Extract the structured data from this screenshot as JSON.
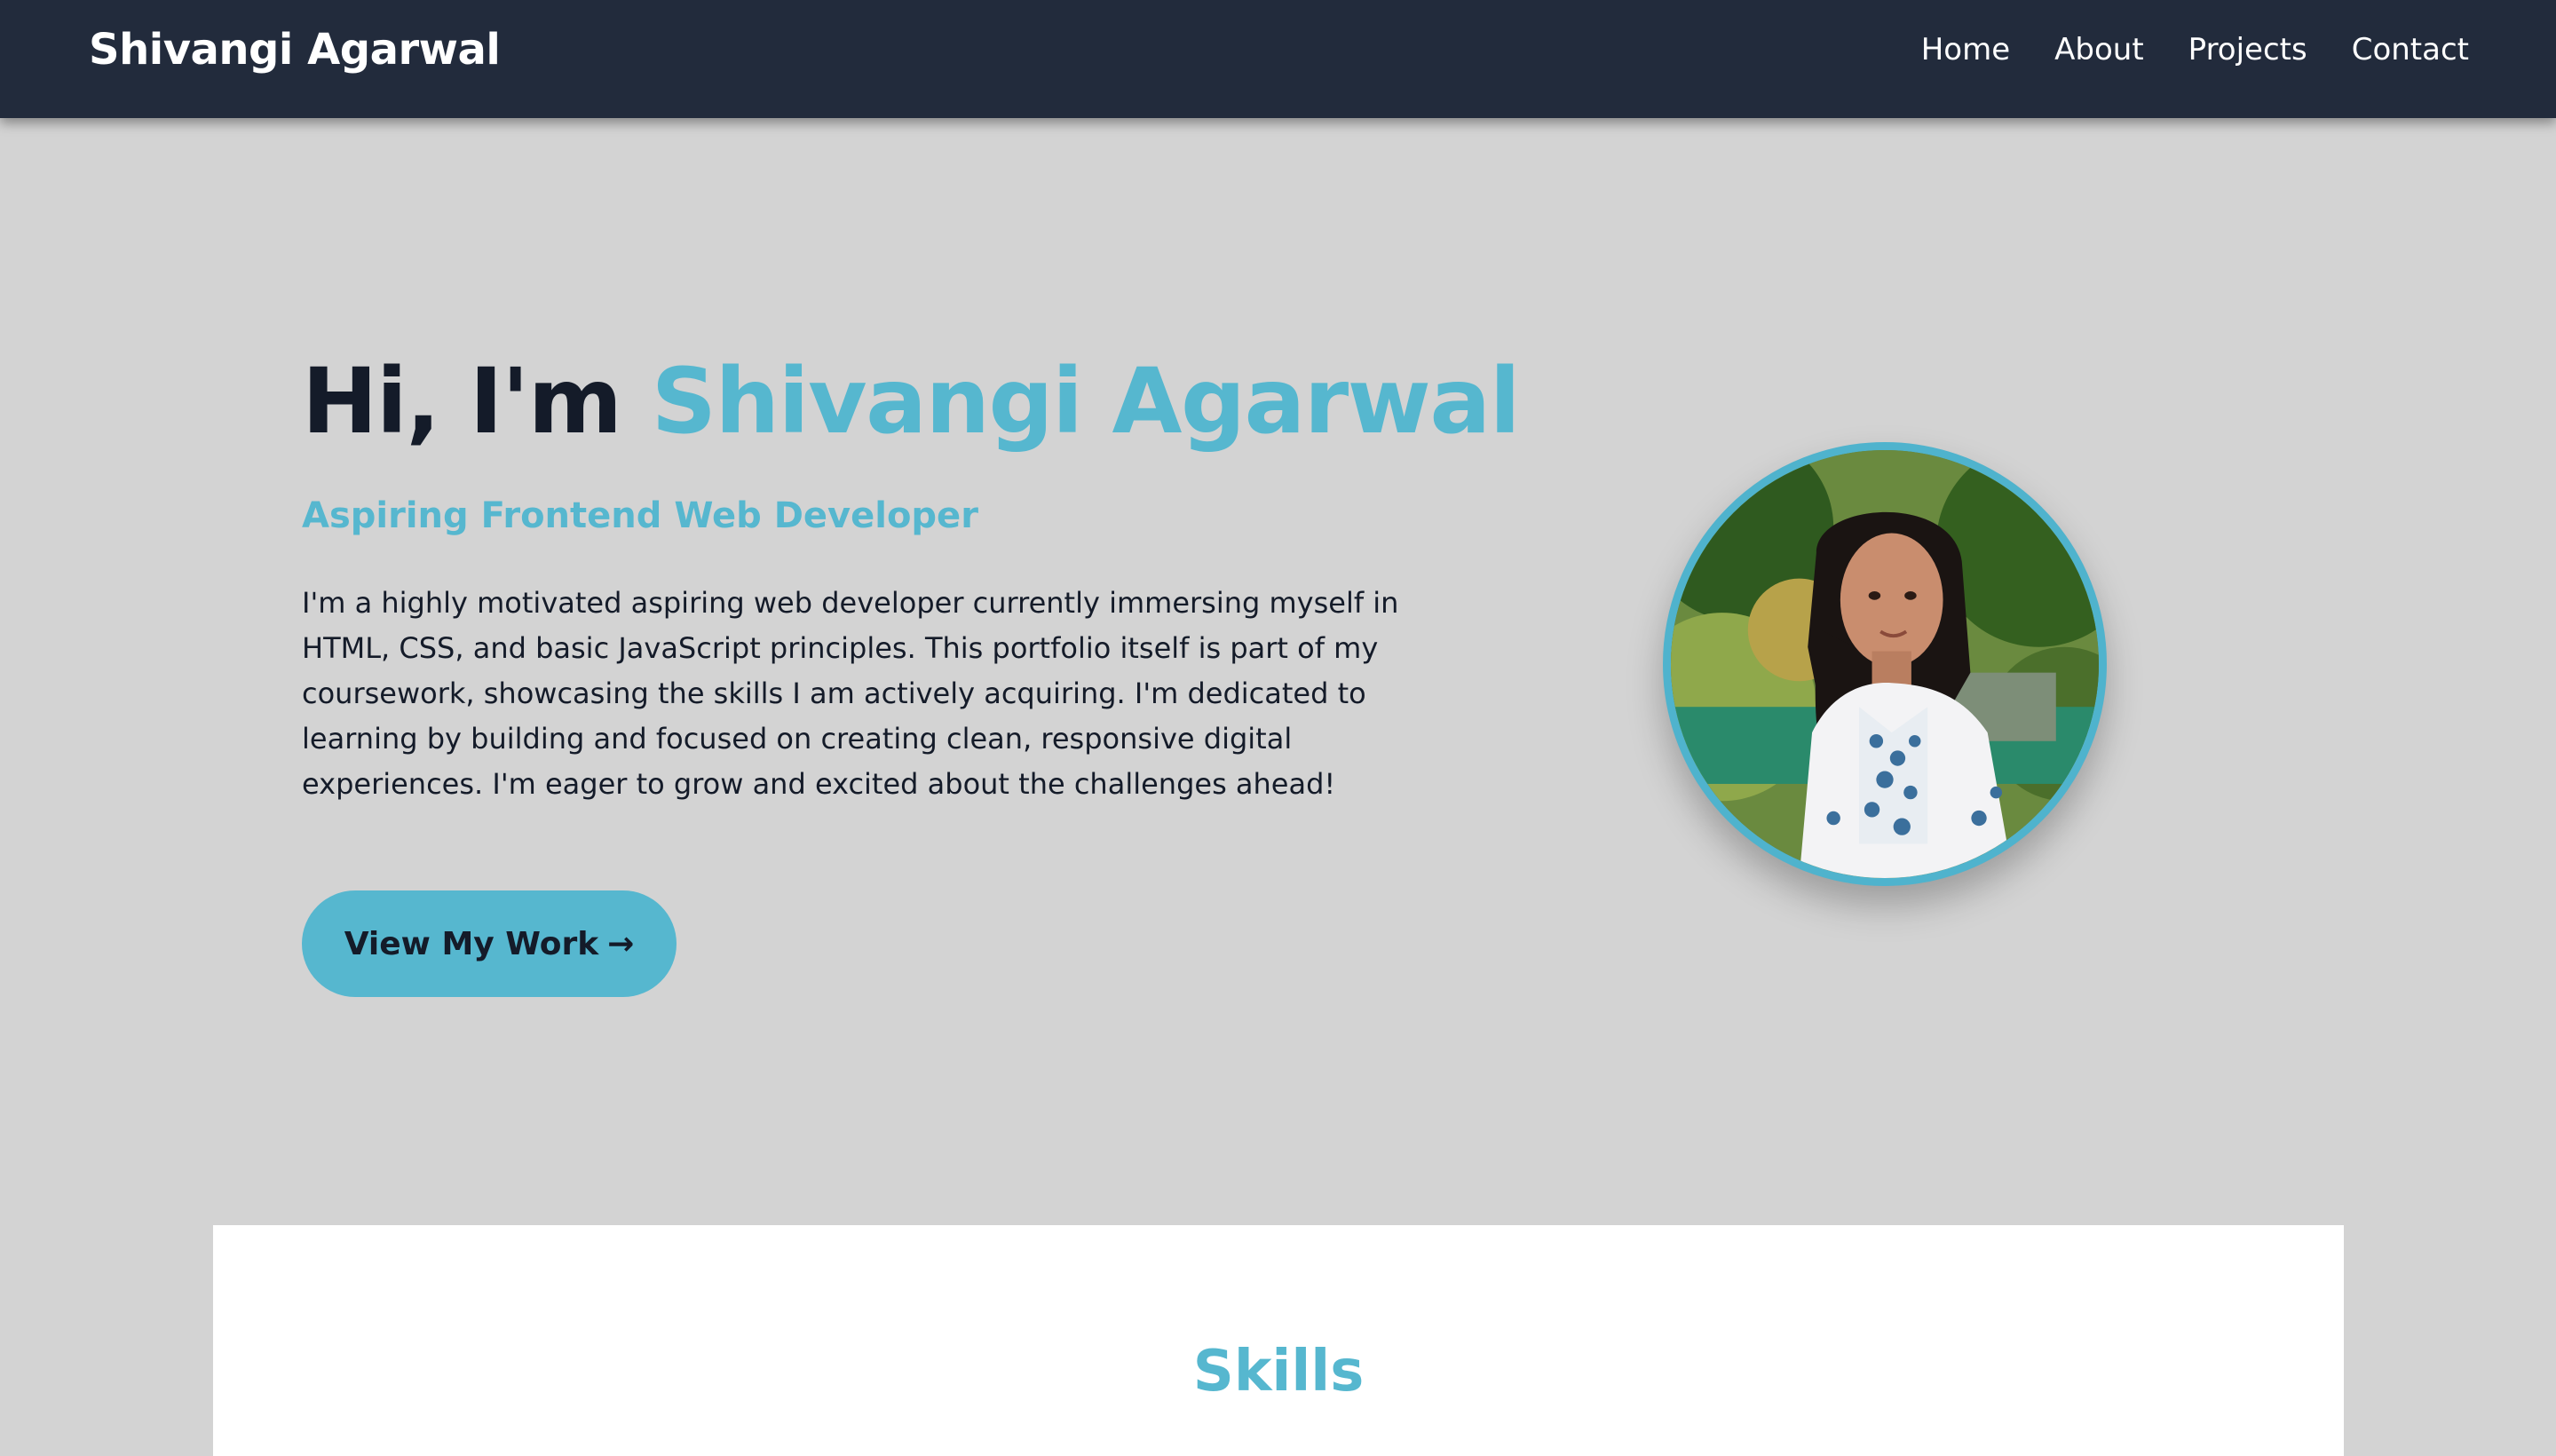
{
  "nav": {
    "brand": "Shivangi Agarwal",
    "links": [
      "Home",
      "About",
      "Projects",
      "Contact"
    ]
  },
  "hero": {
    "greeting": "Hi, I'm",
    "name": "Shivangi Agarwal",
    "subtitle": "Aspiring Frontend Web Developer",
    "description": "I'm a highly motivated aspiring web developer currently immersing myself in HTML, CSS, and basic JavaScript principles. This portfolio itself is part of my coursework, showcasing the skills I am actively acquiring. I'm dedicated to learning by building and focused on creating clean, responsive digital experiences. I'm eager to grow and excited about the challenges ahead!",
    "cta_label": "View My Work",
    "cta_arrow": "→"
  },
  "skills": {
    "title": "Skills"
  },
  "colors": {
    "nav_bg": "#222b3c",
    "page_bg": "#d3d3d3",
    "accent": "#56b7cf",
    "text_dark": "#141b29"
  },
  "icons": {
    "cta_arrow": "arrow-right-icon"
  }
}
